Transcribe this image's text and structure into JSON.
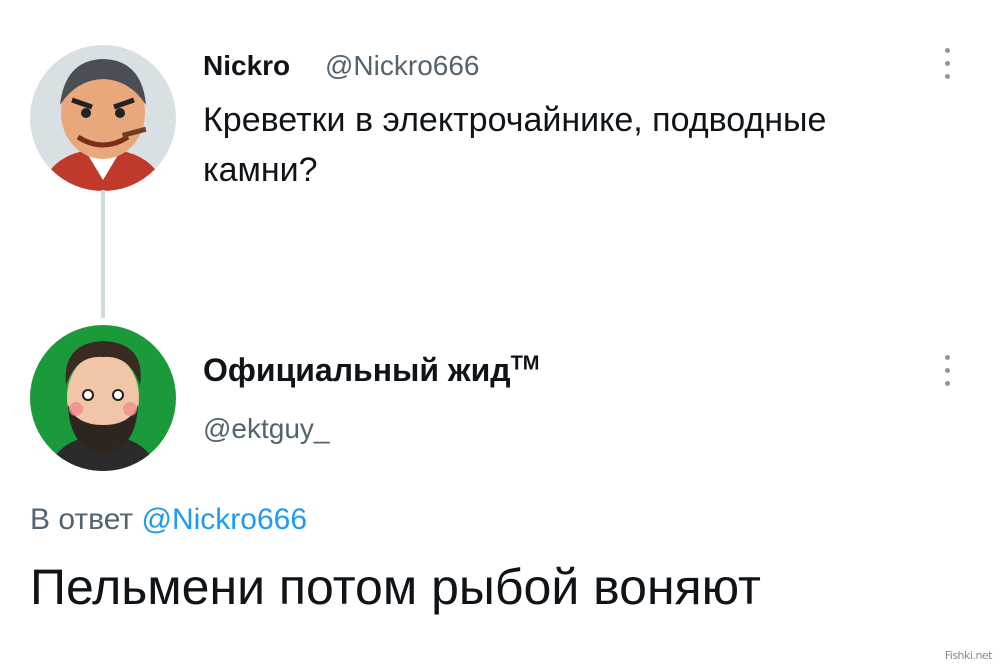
{
  "tweet": {
    "author_name": "Nickro",
    "author_handle": "@Nickro666",
    "text": "Креветки в электрочайнике, подводные камни?",
    "more_icon": "more-vertical-icon"
  },
  "reply": {
    "author_name": "Официальный жид",
    "trademark": "TM",
    "author_handle": "@ektguy_",
    "reply_prefix": "В ответ",
    "reply_to_handle": "@Nickro666",
    "text": "Пельмени потом рыбой воняют",
    "more_icon": "more-vertical-icon"
  },
  "watermark": "Fishki.net",
  "colors": {
    "link": "#1d9bf0",
    "secondary_text": "#536471",
    "thread_line": "#cfd9de",
    "avatar2_bg": "#1a9a3a"
  }
}
